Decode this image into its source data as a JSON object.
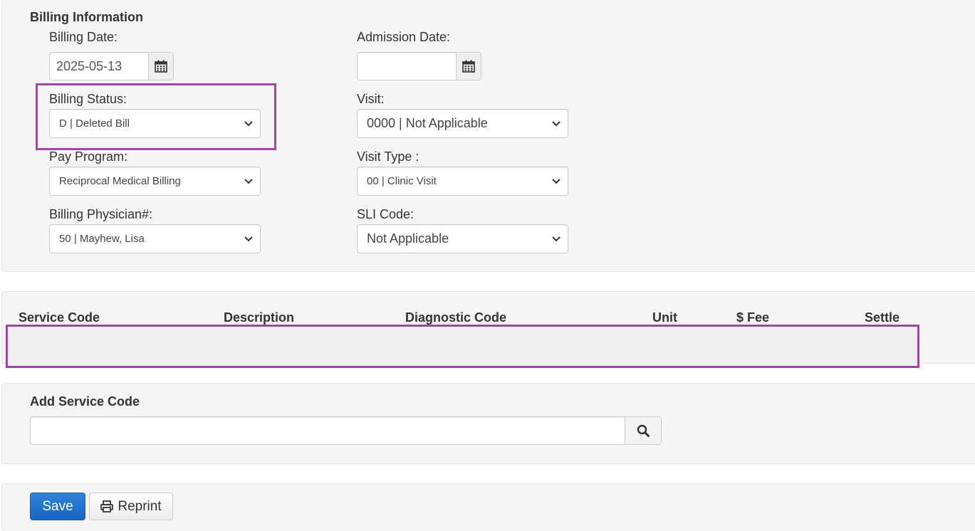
{
  "billing": {
    "section_title": "Billing Information",
    "billing_date_label": "Billing Date:",
    "billing_date_value": "2025-05-13",
    "admission_date_label": "Admission Date:",
    "admission_date_value": "",
    "billing_status_label": "Billing Status:",
    "billing_status_value": "D | Deleted Bill",
    "visit_label": "Visit:",
    "visit_value": "0000 | Not Applicable",
    "pay_program_label": "Pay Program:",
    "pay_program_value": "Reciprocal Medical Billing",
    "visit_type_label": "Visit Type :",
    "visit_type_value": "00 | Clinic Visit",
    "physician_label": "Billing Physician#:",
    "physician_value": "50 | Mayhew, Lisa",
    "sli_label": "SLI Code:",
    "sli_value": "Not Applicable"
  },
  "service_table": {
    "columns": [
      "Service Code",
      "Description",
      "Diagnostic Code",
      "Unit",
      "$ Fee",
      "Settle"
    ],
    "rows": []
  },
  "add_service": {
    "title": "Add Service Code",
    "input_value": ""
  },
  "actions": {
    "save_label": "Save",
    "reprint_label": "Reprint"
  },
  "colors": {
    "highlight": "#9b4a9f",
    "primary": "#1765c0",
    "panel": "#f5f5f5"
  },
  "icons": {
    "calendar": "calendar-icon",
    "chevron": "chevron-down-icon",
    "search": "search-icon",
    "print": "print-icon"
  }
}
